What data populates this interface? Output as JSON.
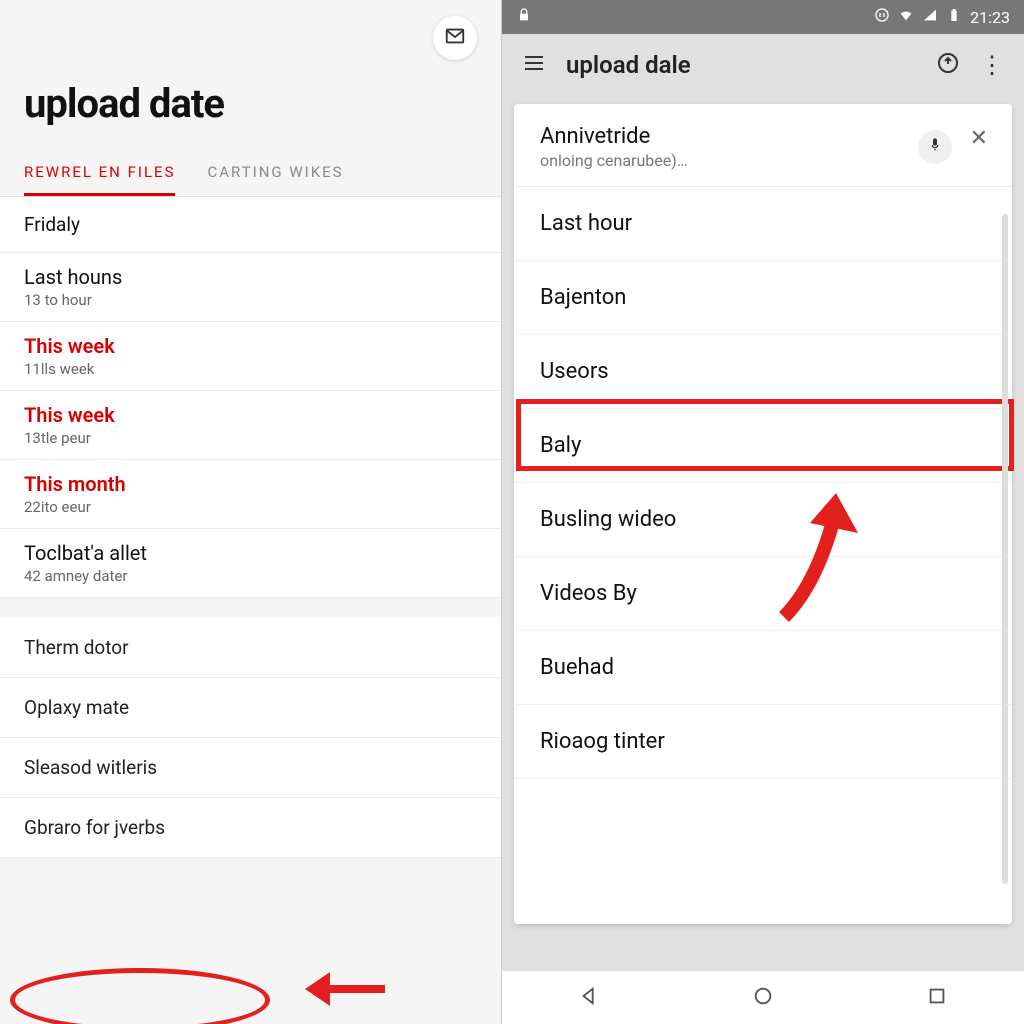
{
  "left": {
    "page_title": "upload date",
    "tabs": [
      {
        "label": "REWREL EN FILES",
        "active": true
      },
      {
        "label": "CARTING WIKES",
        "active": false
      }
    ],
    "filters": [
      {
        "label": "Fridaly",
        "sub": "",
        "red": false,
        "first": true
      },
      {
        "label": "Last houns",
        "sub": "13 to hour",
        "red": false
      },
      {
        "label": "This week",
        "sub": "11lls week",
        "red": true
      },
      {
        "label": "This week",
        "sub": "13tle peur",
        "red": true
      },
      {
        "label": "This month",
        "sub": "22ito eeur",
        "red": true
      },
      {
        "label": "Toclbat'a allet",
        "sub": "42 amney dater",
        "red": false
      }
    ],
    "sublist": [
      "Therm dotor",
      "Oplaxy mate",
      "Sleasod witleris",
      "Gbraro for jverbs"
    ]
  },
  "right": {
    "status_time": "21:23",
    "appbar_title": "upload dale",
    "card": {
      "header_title": "Annivetride",
      "header_sub": "onloing cenarubee)…",
      "items": [
        "Last hour",
        "Bajenton",
        "Useors",
        "Baly",
        "Busling wideo",
        "Videos By",
        "Buehad",
        "Rioaog tinter"
      ],
      "highlight_index": 3
    }
  },
  "colors": {
    "accent": "#d60000",
    "highlight": "#e2201e"
  }
}
